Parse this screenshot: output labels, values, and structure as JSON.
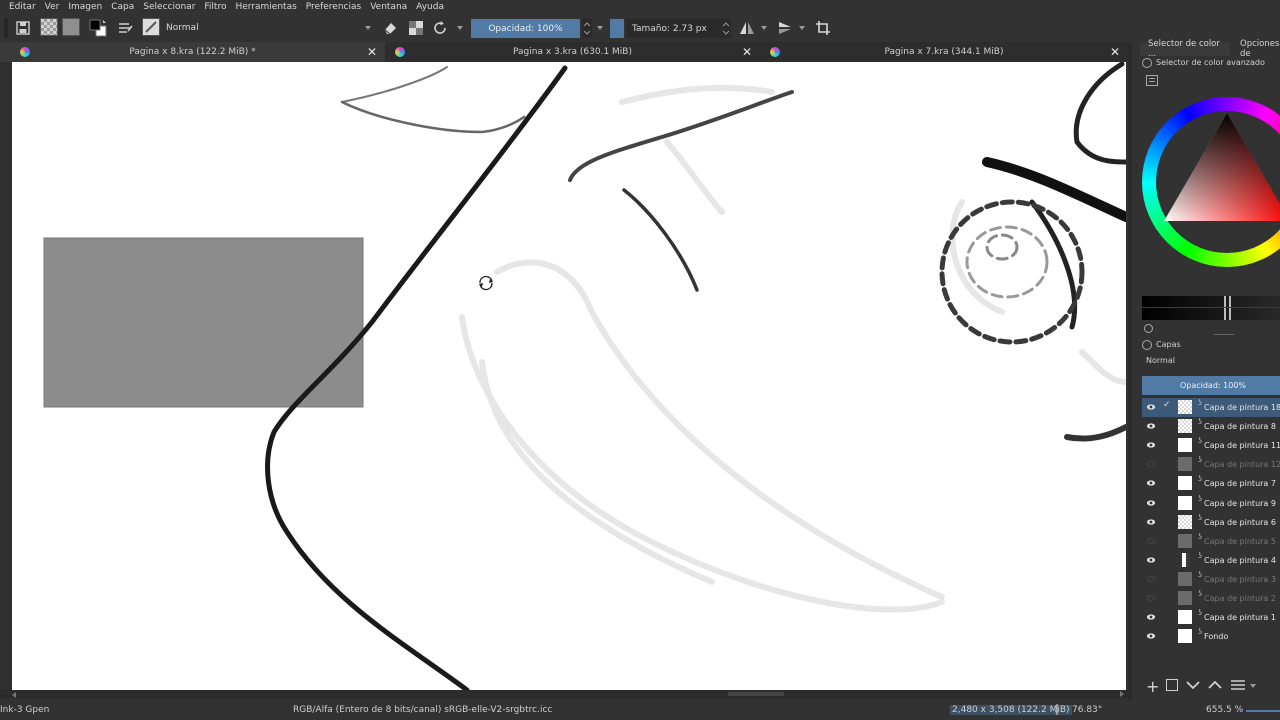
{
  "menu": [
    "Editar",
    "Ver",
    "Imagen",
    "Capa",
    "Seleccionar",
    "Filtro",
    "Herramientas",
    "Preferencias",
    "Ventana",
    "Ayuda"
  ],
  "toolbar": {
    "blend_mode": "Normal",
    "opacity": "Opacidad: 100%",
    "size": "Tamaño: 2.73 px"
  },
  "tabs": [
    {
      "title": "Pagina x 8.kra (122.2 MiB) *"
    },
    {
      "title": "Pagina x 3.kra (630.1 MiB)"
    },
    {
      "title": "Pagina x 7.kra (344.1 MiB)"
    }
  ],
  "dock": {
    "tab1": "Selector de color ...",
    "tab2": "Opciones de",
    "color_panel_title": "Selector de color avanzado",
    "layers_title": "Capas",
    "blend_mode": "Normal",
    "opacity": "Opacidad:  100%"
  },
  "layers": [
    {
      "name": "Capa de pintura 18",
      "visible": true,
      "selected": true,
      "checked": true,
      "thumb": "checker"
    },
    {
      "name": "Capa de pintura 8",
      "visible": true,
      "selected": false,
      "checked": false,
      "thumb": "checker"
    },
    {
      "name": "Capa de pintura 11",
      "visible": true,
      "selected": false,
      "checked": false,
      "thumb": "white"
    },
    {
      "name": "Capa de pintura 12",
      "visible": false,
      "selected": false,
      "checked": false,
      "thumb": "grey"
    },
    {
      "name": "Capa de pintura 7",
      "visible": true,
      "selected": false,
      "checked": false,
      "thumb": "white"
    },
    {
      "name": "Capa de pintura 9",
      "visible": true,
      "selected": false,
      "checked": false,
      "thumb": "white"
    },
    {
      "name": "Capa de pintura 6",
      "visible": true,
      "selected": false,
      "checked": false,
      "thumb": "checker"
    },
    {
      "name": "Capa de pintura 5",
      "visible": false,
      "selected": false,
      "checked": false,
      "thumb": "grey"
    },
    {
      "name": "Capa de pintura 4",
      "visible": true,
      "selected": false,
      "checked": false,
      "thumb": "bar"
    },
    {
      "name": "Capa de pintura 3",
      "visible": false,
      "selected": false,
      "checked": false,
      "thumb": "grey"
    },
    {
      "name": "Capa de pintura 2",
      "visible": false,
      "selected": false,
      "checked": false,
      "thumb": "grey"
    },
    {
      "name": "Capa de pintura 1",
      "visible": true,
      "selected": false,
      "checked": false,
      "thumb": "white"
    },
    {
      "name": "Fondo",
      "visible": true,
      "selected": false,
      "checked": false,
      "thumb": "white"
    }
  ],
  "status": {
    "brush": "Ink-3 Gpen",
    "color_space": "RGB/Alfa (Entero de 8 bits/canal)  sRGB-elle-V2-srgbtrc.icc",
    "doc_size": "2,480 x 3,508 (122.2 MiB)",
    "rotation": "76.83°",
    "zoom": "655.5 %"
  },
  "colors": {
    "accent": "#517ba4",
    "background": "#323232",
    "canvas": "#ffffff",
    "rect_fill": "#8c8c8c"
  }
}
